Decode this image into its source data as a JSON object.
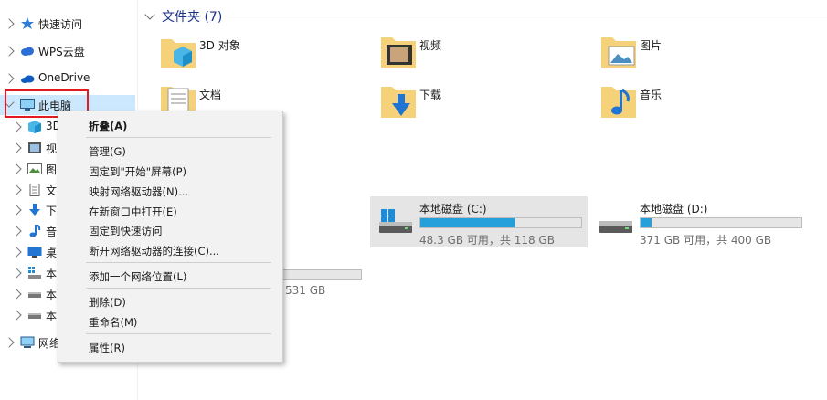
{
  "sidebar": {
    "items": [
      {
        "label": "快速访问",
        "icon": "star-icon"
      },
      {
        "label": "WPS云盘",
        "icon": "cloud-icon"
      },
      {
        "label": "OneDrive",
        "icon": "onedrive-cloud-icon"
      },
      {
        "label": "此电脑",
        "icon": "monitor-icon"
      },
      {
        "label": "3D",
        "icon": "3d-object-icon"
      },
      {
        "label": "视",
        "icon": "video-icon"
      },
      {
        "label": "图",
        "icon": "picture-icon"
      },
      {
        "label": "文",
        "icon": "document-icon"
      },
      {
        "label": "下",
        "icon": "download-icon"
      },
      {
        "label": "音",
        "icon": "music-icon"
      },
      {
        "label": "桌",
        "icon": "desktop-icon"
      },
      {
        "label": "本",
        "icon": "windows-drive-icon"
      },
      {
        "label": "本",
        "icon": "drive-icon"
      },
      {
        "label": "本",
        "icon": "drive-icon"
      },
      {
        "label": "网络",
        "icon": "network-icon"
      }
    ]
  },
  "folders": {
    "header": "文件夹 (7)",
    "items": [
      {
        "label": "3D 对象",
        "icon": "3d-objects-folder-icon"
      },
      {
        "label": "视频",
        "icon": "videos-folder-icon"
      },
      {
        "label": "图片",
        "icon": "pictures-folder-icon"
      },
      {
        "label": "文档",
        "icon": "documents-folder-icon"
      },
      {
        "label": "下载",
        "icon": "downloads-folder-icon"
      },
      {
        "label": "音乐",
        "icon": "music-folder-icon"
      }
    ]
  },
  "drives": [
    {
      "name": "本地磁盘 (C:)",
      "info": "48.3 GB 可用，共 118 GB",
      "used_fraction": 0.59,
      "icon": "windows-drive-icon",
      "selected": true
    },
    {
      "name": "本地磁盘 (D:)",
      "info": "371 GB 可用，共 400 GB",
      "used_fraction": 0.07,
      "icon": "drive-icon",
      "selected": false
    }
  ],
  "partial": {
    "third_drive_info": "531 GB"
  },
  "context_menu": {
    "items": [
      {
        "label": "折叠(A)",
        "bold": true
      },
      {
        "label": "管理(G)"
      },
      {
        "label": "固定到\"开始\"屏幕(P)"
      },
      {
        "label": "映射网络驱动器(N)..."
      },
      {
        "label": "在新窗口中打开(E)"
      },
      {
        "label": "固定到快速访问"
      },
      {
        "label": "断开网络驱动器的连接(C)..."
      },
      {
        "label": "添加一个网络位置(L)"
      },
      {
        "label": "删除(D)"
      },
      {
        "label": "重命名(M)"
      },
      {
        "label": "属性(R)"
      }
    ]
  },
  "colors": {
    "accent": "#26a0da",
    "selection": "#cce8ff",
    "highlight_box": "#e21b23",
    "header_text": "#1e3287"
  }
}
